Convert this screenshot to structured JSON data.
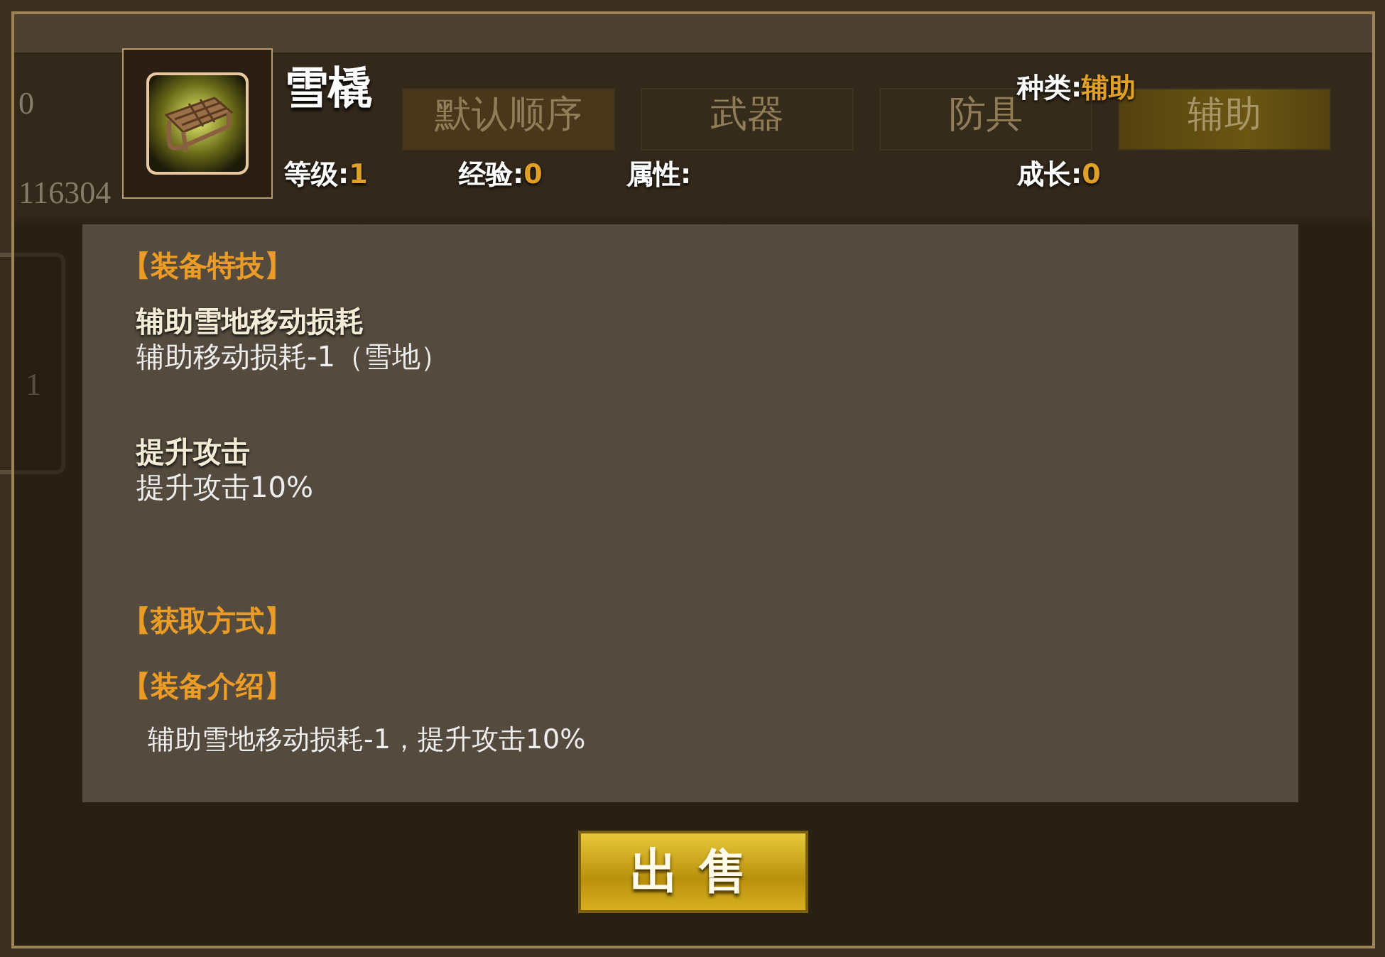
{
  "background": {
    "texts": [
      "0",
      "116304",
      "1"
    ],
    "tabs": [
      {
        "label": "默认顺序",
        "selected": false
      },
      {
        "label": "武器",
        "selected": false
      },
      {
        "label": "防具",
        "selected": false
      },
      {
        "label": "辅助",
        "selected": true
      }
    ]
  },
  "item": {
    "name": "雪橇",
    "category": {
      "label": "种类:",
      "value": "辅助"
    },
    "stats": [
      {
        "label": "等级:",
        "value": "1"
      },
      {
        "label": "经验:",
        "value": "0"
      },
      {
        "label": "属性:"
      },
      {
        "label": "成长:",
        "value": "0"
      }
    ]
  },
  "sections": [
    {
      "kind": "heading",
      "text": "【装备特技】"
    },
    {
      "kind": "skill",
      "name": "辅助雪地移动损耗",
      "desc": "辅助移动损耗-1（雪地）"
    },
    {
      "kind": "skill",
      "name": "提升攻击",
      "desc": "提升攻击10%"
    },
    {
      "kind": "heading",
      "text": "【获取方式】"
    },
    {
      "kind": "heading",
      "text": "【装备介绍】"
    },
    {
      "kind": "intro",
      "text": "辅助雪地移动损耗-1，提升攻击10%"
    }
  ],
  "sell_button": "出售"
}
